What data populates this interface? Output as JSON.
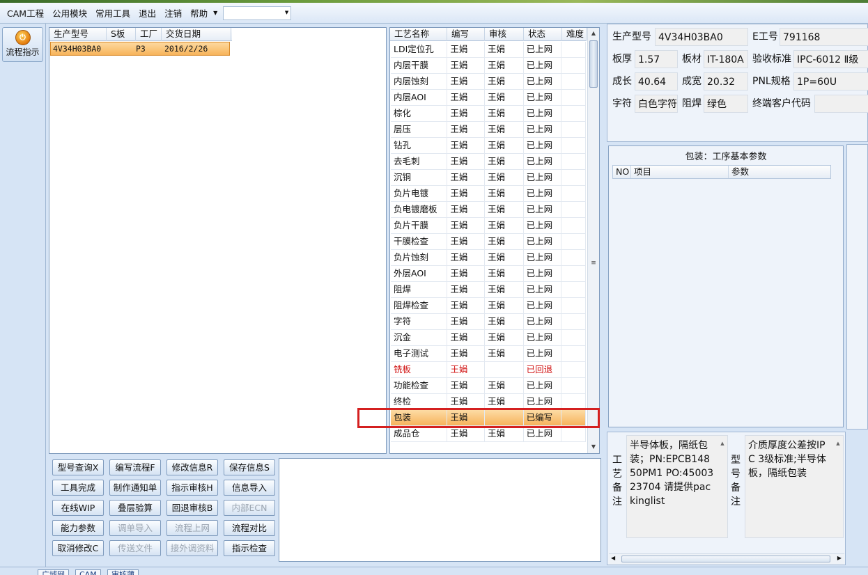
{
  "menu": {
    "items": [
      "CAM工程",
      "公用模块",
      "常用工具",
      "退出",
      "注销",
      "帮助"
    ],
    "combo_value": ""
  },
  "leftbar": {
    "flow_button_label": "流程指示"
  },
  "model_list": {
    "headers": [
      "生产型号",
      "S板",
      "工厂",
      "交货日期"
    ],
    "rows": [
      {
        "model": "4V34H03BA0",
        "s_board": "",
        "factory": "P3",
        "delivery_date": "2016/2/26"
      }
    ]
  },
  "process_table": {
    "headers": [
      "工艺名称",
      "编写",
      "审核",
      "状态",
      "难度"
    ],
    "rows": [
      {
        "name": "LDI定位孔",
        "writer": "王娟",
        "reviewer": "王娟",
        "status": "已上网",
        "difficulty": ""
      },
      {
        "name": "内层干膜",
        "writer": "王娟",
        "reviewer": "王娟",
        "status": "已上网",
        "difficulty": ""
      },
      {
        "name": "内层蚀刻",
        "writer": "王娟",
        "reviewer": "王娟",
        "status": "已上网",
        "difficulty": ""
      },
      {
        "name": "内层AOI",
        "writer": "王娟",
        "reviewer": "王娟",
        "status": "已上网",
        "difficulty": ""
      },
      {
        "name": "棕化",
        "writer": "王娟",
        "reviewer": "王娟",
        "status": "已上网",
        "difficulty": ""
      },
      {
        "name": "层压",
        "writer": "王娟",
        "reviewer": "王娟",
        "status": "已上网",
        "difficulty": ""
      },
      {
        "name": "钻孔",
        "writer": "王娟",
        "reviewer": "王娟",
        "status": "已上网",
        "difficulty": ""
      },
      {
        "name": "去毛刺",
        "writer": "王娟",
        "reviewer": "王娟",
        "status": "已上网",
        "difficulty": ""
      },
      {
        "name": "沉铜",
        "writer": "王娟",
        "reviewer": "王娟",
        "status": "已上网",
        "difficulty": ""
      },
      {
        "name": "负片电镀",
        "writer": "王娟",
        "reviewer": "王娟",
        "status": "已上网",
        "difficulty": ""
      },
      {
        "name": "负电镀磨板",
        "writer": "王娟",
        "reviewer": "王娟",
        "status": "已上网",
        "difficulty": ""
      },
      {
        "name": "负片干膜",
        "writer": "王娟",
        "reviewer": "王娟",
        "status": "已上网",
        "difficulty": ""
      },
      {
        "name": "干膜检查",
        "writer": "王娟",
        "reviewer": "王娟",
        "status": "已上网",
        "difficulty": ""
      },
      {
        "name": "负片蚀刻",
        "writer": "王娟",
        "reviewer": "王娟",
        "status": "已上网",
        "difficulty": ""
      },
      {
        "name": "外层AOI",
        "writer": "王娟",
        "reviewer": "王娟",
        "status": "已上网",
        "difficulty": ""
      },
      {
        "name": "阻焊",
        "writer": "王娟",
        "reviewer": "王娟",
        "status": "已上网",
        "difficulty": ""
      },
      {
        "name": "阻焊检查",
        "writer": "王娟",
        "reviewer": "王娟",
        "status": "已上网",
        "difficulty": ""
      },
      {
        "name": "字符",
        "writer": "王娟",
        "reviewer": "王娟",
        "status": "已上网",
        "difficulty": ""
      },
      {
        "name": "沉金",
        "writer": "王娟",
        "reviewer": "王娟",
        "status": "已上网",
        "difficulty": ""
      },
      {
        "name": "电子测试",
        "writer": "王娟",
        "reviewer": "王娟",
        "status": "已上网",
        "difficulty": ""
      },
      {
        "name": "铣板",
        "writer": "王娟",
        "reviewer": "",
        "status": "已回退",
        "difficulty": "",
        "state": "returned"
      },
      {
        "name": "功能检查",
        "writer": "王娟",
        "reviewer": "王娟",
        "status": "已上网",
        "difficulty": ""
      },
      {
        "name": "终检",
        "writer": "王娟",
        "reviewer": "王娟",
        "status": "已上网",
        "difficulty": ""
      },
      {
        "name": "包装",
        "writer": "王娟",
        "reviewer": "",
        "status": "已编写",
        "difficulty": "",
        "state": "selected"
      },
      {
        "name": "成品仓",
        "writer": "王娟",
        "reviewer": "王娟",
        "status": "已上网",
        "difficulty": ""
      }
    ]
  },
  "buttons": [
    {
      "label": "型号查询X",
      "enabled": true
    },
    {
      "label": "编写流程F",
      "enabled": true
    },
    {
      "label": "修改信息R",
      "enabled": true
    },
    {
      "label": "保存信息S",
      "enabled": true
    },
    {
      "label": "工具完成",
      "enabled": true
    },
    {
      "label": "制作通知单",
      "enabled": true
    },
    {
      "label": "指示审核H",
      "enabled": true
    },
    {
      "label": "信息导入",
      "enabled": true
    },
    {
      "label": "在线WIP",
      "enabled": true
    },
    {
      "label": "叠层验算",
      "enabled": true
    },
    {
      "label": "回退审核B",
      "enabled": true
    },
    {
      "label": "内部ECN",
      "enabled": false
    },
    {
      "label": "能力参数",
      "enabled": true
    },
    {
      "label": "调单导入",
      "enabled": false
    },
    {
      "label": "流程上网",
      "enabled": false
    },
    {
      "label": "流程对比",
      "enabled": true
    },
    {
      "label": "取消修改C",
      "enabled": true
    },
    {
      "label": "传送文件",
      "enabled": false
    },
    {
      "label": "接外调资料",
      "enabled": false
    },
    {
      "label": "指示检查",
      "enabled": true
    }
  ],
  "info": {
    "model_label": "生产型号",
    "model_value": "4V34H03BA0",
    "e_label": "E工号",
    "e_value": "791168",
    "thickness_label": "板厚",
    "thickness_value": "1.57",
    "material_label": "板材",
    "material_value": "IT-180A",
    "standard_label": "验收标准",
    "standard_value": "IPC-6012 Ⅱ级",
    "length_label": "成长",
    "length_value": "40.64",
    "width_label": "成宽",
    "width_value": "20.32",
    "pnl_label": "PNL规格",
    "pnl_value": "1P=60U",
    "char_label": "字符",
    "char_value": "白色字符",
    "mask_label": "阻焊",
    "mask_value": "绿色",
    "customer_code_label": "终端客户代码",
    "customer_code_value": ""
  },
  "params": {
    "title": "包装：工序基本参数",
    "headers": [
      "NO",
      "项目",
      "参数"
    ]
  },
  "remarks": {
    "process_label": "工艺备注",
    "process_text": "半导体板，隔纸包装；PN:EPCB14850PM1 PO:4500323704 请提供packinglist",
    "model_label": "型号备注",
    "model_text": "介质厚度公差按IPC 3级标准;半导体板，隔纸包装"
  },
  "bottom_tabs": [
    "广域网",
    "CAM",
    "审核薄"
  ],
  "colors": {
    "selected_row": "#f7b45a",
    "returned_text": "#d01010",
    "highlight_box": "#d42020"
  }
}
